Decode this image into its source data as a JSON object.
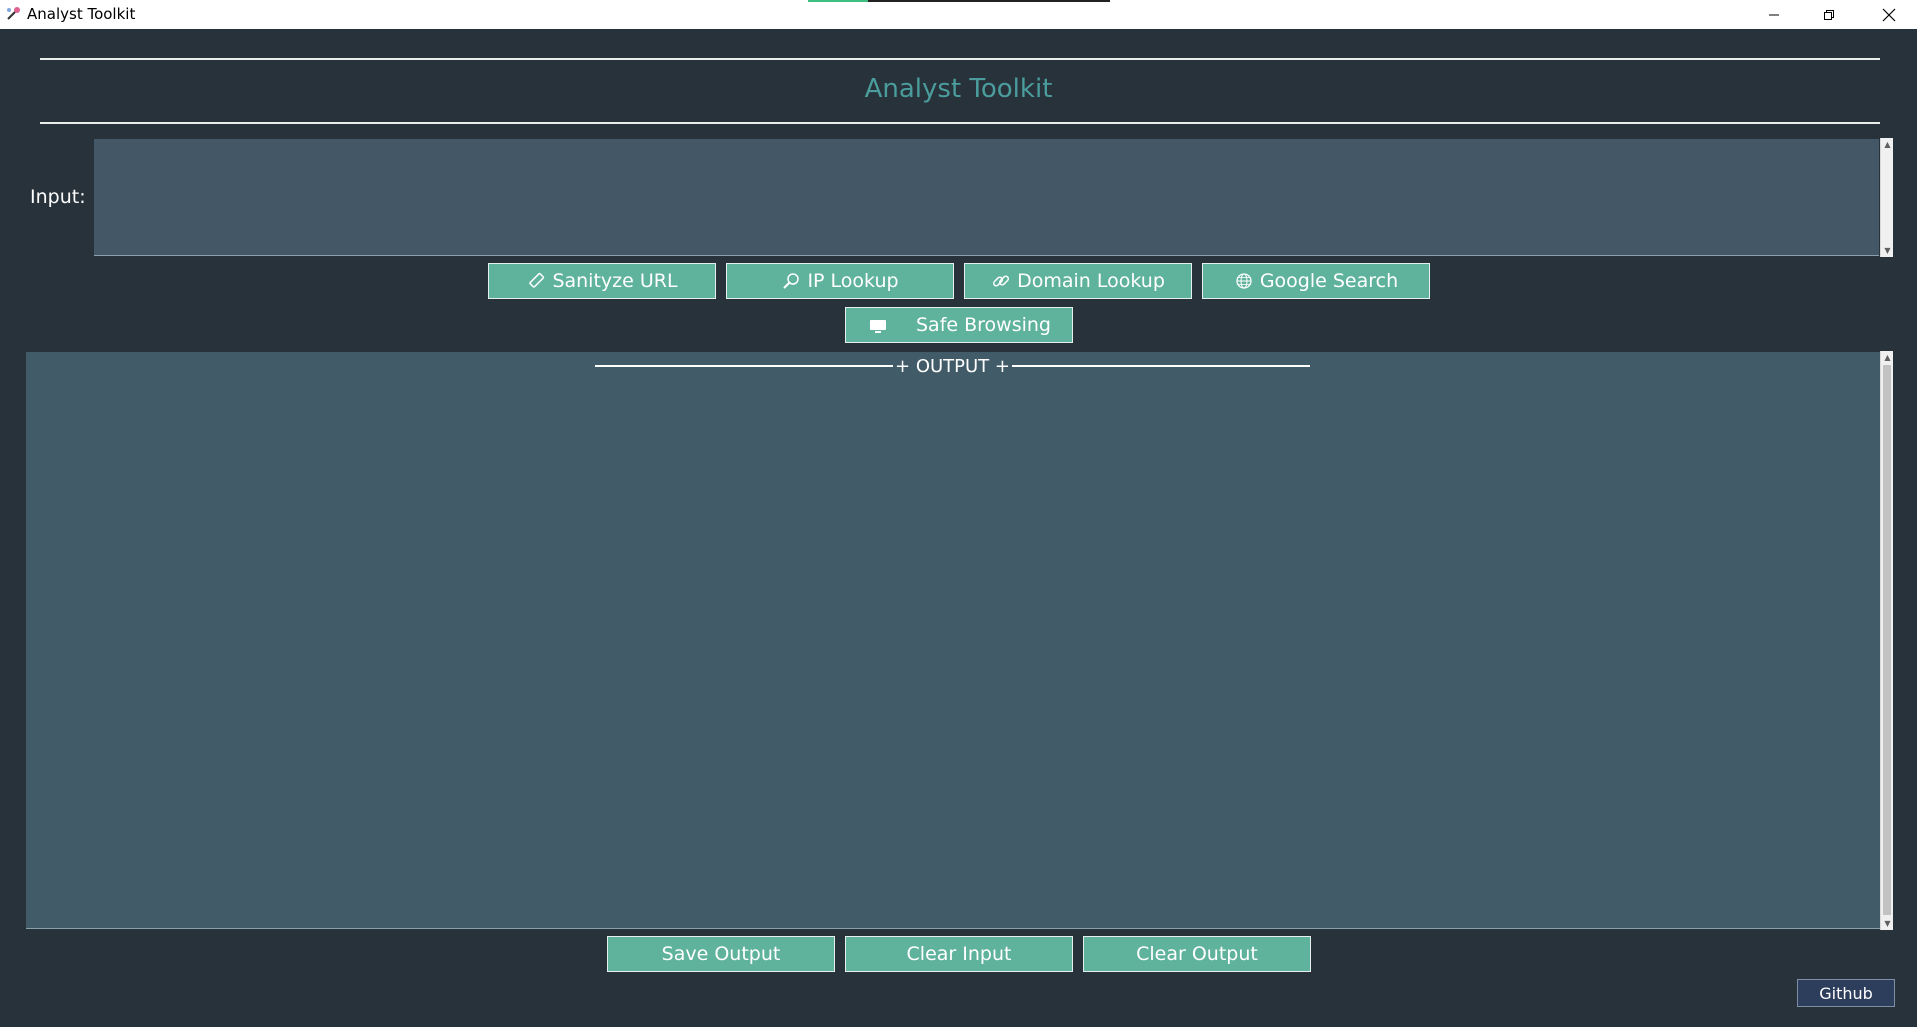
{
  "window": {
    "title": "Analyst Toolkit",
    "minimize_glyph": "—",
    "restore_glyph": "❐",
    "close_glyph": "✕"
  },
  "header": {
    "title": "Analyst Toolkit"
  },
  "input": {
    "label": "Input:",
    "value": ""
  },
  "actions": {
    "sanitize_url": {
      "label": "Sanityze URL",
      "icon": "eraser-icon"
    },
    "ip_lookup": {
      "label": "IP Lookup",
      "icon": "magnifier-icon"
    },
    "domain_lookup": {
      "label": "Domain Lookup",
      "icon": "link-icon"
    },
    "google_search": {
      "label": "Google Search",
      "icon": "globe-icon"
    },
    "safe_browsing": {
      "label": "Safe Browsing",
      "icon": "monitor-icon"
    }
  },
  "output": {
    "header": "+ OUTPUT +",
    "value": ""
  },
  "footer": {
    "save_output": "Save Output",
    "clear_input": "Clear Input",
    "clear_output": "Clear Output",
    "github": "Github"
  },
  "colors": {
    "background": "#27323a",
    "title_accent": "#4b9c9c",
    "button": "#5fb29b",
    "input_bg": "#445766",
    "output_bg": "#415c68",
    "github_button": "#2d3d5c"
  }
}
